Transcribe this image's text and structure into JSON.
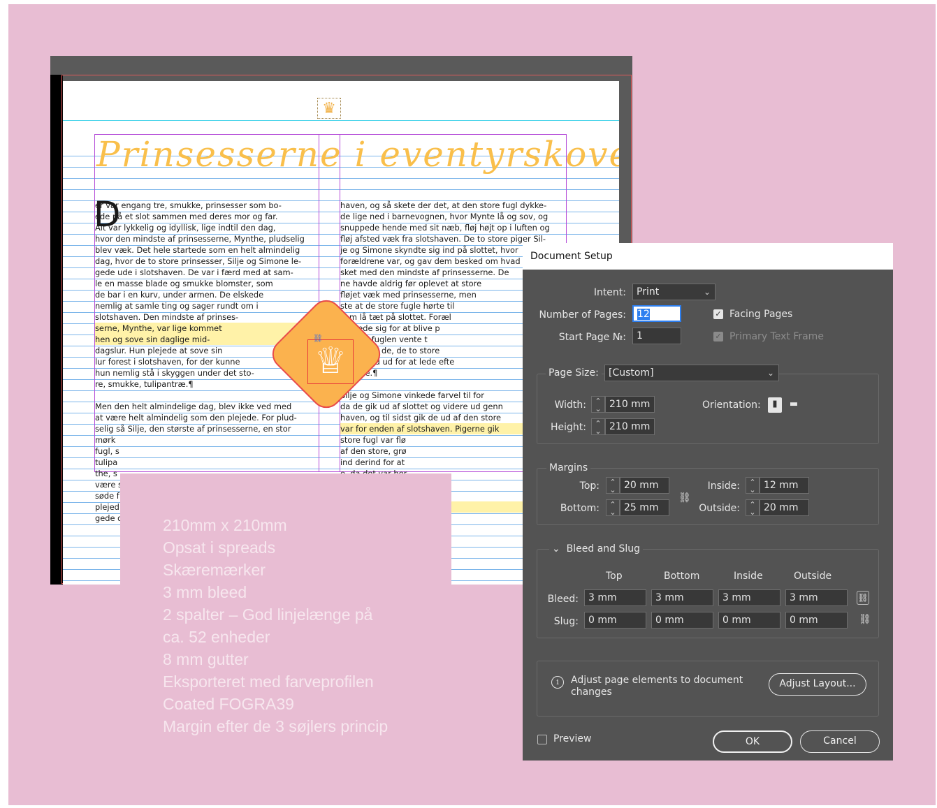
{
  "document": {
    "title": "Prinsesserne i eventyrskoven",
    "pilcrow": "¶",
    "dropcap": "D",
    "col1": [
      {
        "t": "er var engang tre, smukke, prinsesser som bo-",
        "hl": false
      },
      {
        "t": "ede på et slot sammen med deres mor og far.",
        "hl": false
      },
      {
        "t": "Alt var lykkelig og idyllisk, lige indtil den dag,",
        "hl": false
      },
      {
        "t": "hvor den mindste af prinsesserne, Mynthe, pludselig",
        "hl": false
      },
      {
        "t": "blev væk. Det hele startede som en helt almindelig",
        "hl": false
      },
      {
        "t": "dag, hvor de to store prinsesser, Silje og Simone le-",
        "hl": false
      },
      {
        "t": "gede ude i slotshaven. De var i færd med at sam-",
        "hl": false
      },
      {
        "t": "le en masse blade og smukke blomster, som",
        "hl": false
      },
      {
        "t": "de bar i en kurv, under armen. De elskede",
        "hl": false
      },
      {
        "t": "nemlig at samle ting og sager rundt om i",
        "hl": false
      },
      {
        "t": "slotshaven. Den mindste af prinses-",
        "hl": false
      },
      {
        "t": "serne, Mynthe, var lige kommet",
        "hl": true
      },
      {
        "t": "hen og sove sin daglige mid-",
        "hl": true
      },
      {
        "t": "dagslur. Hun plejede at sove sin",
        "hl": false
      },
      {
        "t": "lur forest i slotshaven, for der kunne",
        "hl": false
      },
      {
        "t": "hun nemlig stå i skyggen under det sto-",
        "hl": false
      },
      {
        "t": "re, smukke, tulipantræ.¶",
        "hl": false
      },
      {
        "t": "",
        "hl": false
      },
      {
        "t": "Men den helt almindelige dag, blev ikke ved med",
        "hl": false
      },
      {
        "t": "at være helt almindelig som den plejede. For plud-",
        "hl": false
      },
      {
        "t": "selig så Silje, den største af prinsesserne, en stor",
        "hl": false
      },
      {
        "t": "mørk",
        "hl": false
      },
      {
        "t": "fugl, s",
        "hl": false
      },
      {
        "t": "tulipa",
        "hl": false
      },
      {
        "t": "the, s",
        "hl": false
      },
      {
        "t": "være s",
        "hl": false
      },
      {
        "t": "søde f",
        "hl": false
      },
      {
        "t": "plejed",
        "hl": false
      },
      {
        "t": "gede d",
        "hl": false
      }
    ],
    "col2": [
      {
        "t": "haven, og så skete der det, at den store fugl dykke-",
        "hl": false
      },
      {
        "t": "de lige ned i barnevognen, hvor Mynte lå og sov, og",
        "hl": false
      },
      {
        "t": "snuppede hende med sit næb, fløj højt op i luften og",
        "hl": false
      },
      {
        "t": "fløj afsted væk fra slotshaven. De to store piger Sil-",
        "hl": false
      },
      {
        "t": "je og Simone skyndte sig ind på slottet, hvor",
        "hl": false
      },
      {
        "t": "forældrene var, og gav dem besked om hvad",
        "hl": false
      },
      {
        "t": "sket med den mindste af prinsesserne. De",
        "hl": false
      },
      {
        "t": "ne havde aldrig før oplevet at store",
        "hl": false
      },
      {
        "t": "fløjet væk med prinsesserne, men",
        "hl": false
      },
      {
        "t": "ste at de store fugle hørte til",
        "hl": false
      },
      {
        "t": "som lå tæt på slottet. Foræl",
        "hl": false
      },
      {
        "t": "sluttede sig for at blive p",
        "hl": false
      },
      {
        "t": "hvis nu fuglen vente t",
        "hl": false
      },
      {
        "t": "så sendte de, de to store",
        "hl": false
      },
      {
        "t": "ser afsted ud for at lede efte",
        "hl": false
      },
      {
        "t": "Mynthe.¶",
        "hl": false
      },
      {
        "t": "",
        "hl": false
      },
      {
        "t": "Silje og Simone vinkede farvel til for",
        "hl": false
      },
      {
        "t": "da de gik ud af slottet og videre ud genn",
        "hl": false
      },
      {
        "t": "haven, og til sidst gik de ud af den store",
        "hl": false
      },
      {
        "t": "var for enden af slotshaven. Pigerne gik",
        "hl": true
      },
      {
        "t": "store fugl var flø",
        "hl": false
      },
      {
        "t": "af den store, grø",
        "hl": false
      },
      {
        "t": "ind derind for at",
        "hl": false
      },
      {
        "t": "e, da det var her",
        "hl": false
      },
      {
        "t": "e hørte til.¶",
        "hl": false
      },
      {
        "t": "",
        "hl": false
      },
      {
        "t": "ind i skoven, så",
        "hl": true
      },
      {
        "t": "t før. Men de ville",
        "hl": false
      }
    ]
  },
  "note": {
    "lines": [
      "210mm x 210mm",
      "Opsat i spreads",
      "Skæremærker",
      "3 mm bleed",
      "2 spalter – God linjelænge på",
      "ca. 52 enheder",
      "8 mm gutter",
      "Eksporteret  med farveprofilen",
      "Coated FOGRA39",
      "Margin efter de 3 søjlers princip"
    ]
  },
  "dialog": {
    "title": "Document Setup",
    "intent_label": "Intent:",
    "intent_value": "Print",
    "pages_label": "Number of Pages:",
    "pages_value": "12",
    "start_label": "Start Page №:",
    "start_value": "1",
    "facing_label": "Facing Pages",
    "facing_checked": true,
    "primary_label": "Primary Text Frame",
    "primary_checked": true,
    "page_size_label": "Page Size:",
    "page_size_value": "[Custom]",
    "width_label": "Width:",
    "width_value": "210 mm",
    "height_label": "Height:",
    "height_value": "210 mm",
    "orientation_label": "Orientation:",
    "margins_label": "Margins",
    "top_label": "Top:",
    "top_value": "20 mm",
    "bottom_label": "Bottom:",
    "bottom_value": "25 mm",
    "inside_label": "Inside:",
    "inside_value": "12 mm",
    "outside_label": "Outside:",
    "outside_value": "20 mm",
    "bleed_slug_label": "Bleed and Slug",
    "cols": [
      "Top",
      "Bottom",
      "Inside",
      "Outside"
    ],
    "bleed_label": "Bleed:",
    "bleed_values": [
      "3 mm",
      "3 mm",
      "3 mm",
      "3 mm"
    ],
    "slug_label": "Slug:",
    "slug_values": [
      "0 mm",
      "0 mm",
      "0 mm",
      "0 mm"
    ],
    "adjust_text_1": "Adjust page elements to document",
    "adjust_text_2": "changes",
    "adjust_button": "Adjust Layout...",
    "preview_label": "Preview",
    "preview_checked": false,
    "ok": "OK",
    "cancel": "Cancel"
  },
  "colors": {
    "background": "#e8bdd3",
    "title": "#f9bf4b",
    "dialog_bg": "#535353",
    "highlight": "#fff2a8",
    "frame": "#b44bd8",
    "baseline": "#7bb5ea",
    "accent": "#2d7ff0"
  }
}
